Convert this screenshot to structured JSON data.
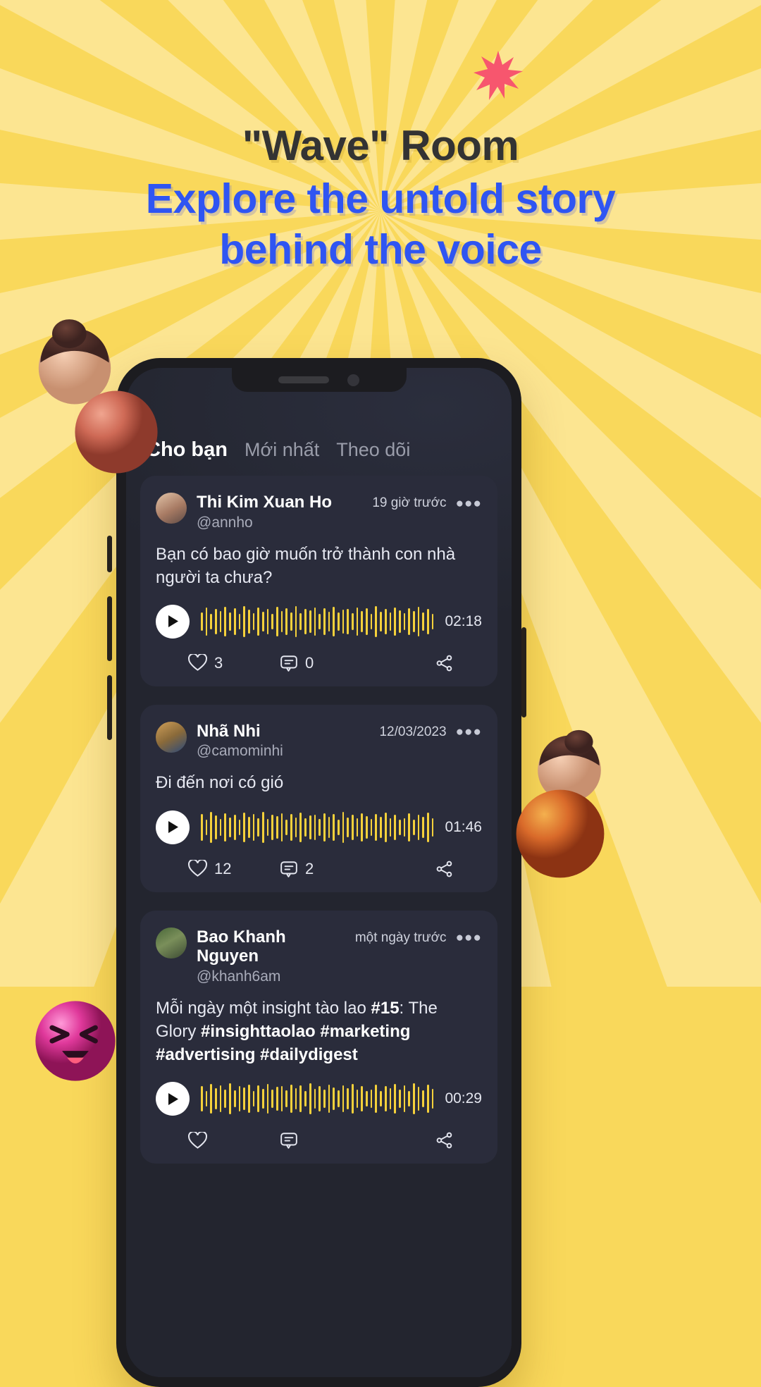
{
  "hero": {
    "title": "\"Wave\" Room",
    "subtitle_line1": "Explore the untold story",
    "subtitle_line2": "behind the voice",
    "title_color": "#333333",
    "subtitle_color": "#2F55F2",
    "background_color": "#F9D85B",
    "spark_color": "#F7566E"
  },
  "app": {
    "tabs": [
      {
        "label": "Cho bạn",
        "active": true
      },
      {
        "label": "Mới nhất",
        "active": false
      },
      {
        "label": "Theo dõi",
        "active": false
      }
    ],
    "accent_color": "#F5D13B",
    "card_color": "#2A2C3B",
    "screen_color": "#23252F",
    "posts": [
      {
        "display_name": "Thi Kim Xuan Ho",
        "handle": "@annho",
        "time": "19 giờ trước",
        "more_icon": "more-horizontal-icon",
        "text": "Bạn có bao giờ muốn trở thành con nhà người ta chưa?",
        "duration": "02:18",
        "likes": "3",
        "comments": "0",
        "share_icon": "share-icon"
      },
      {
        "display_name": "Nhã Nhi",
        "handle": "@camominhi",
        "time": "12/03/2023",
        "more_icon": "more-horizontal-icon",
        "text": "Đi đến nơi có gió",
        "duration": "01:46",
        "likes": "12",
        "comments": "2",
        "share_icon": "share-icon"
      },
      {
        "display_name": "Bao Khanh Nguyen",
        "handle": "@khanh6am",
        "time": "một ngày trước",
        "more_icon": "more-horizontal-icon",
        "text_plain": "Mỗi ngày một insight tào lao ",
        "text_bold_num": "#15",
        "text_tail": ": The Glory",
        "hashtags": "#insighttaolao #marketing #advertising #dailydigest",
        "duration": "00:29",
        "likes": "",
        "comments": "",
        "share_icon": "share-icon"
      }
    ]
  }
}
